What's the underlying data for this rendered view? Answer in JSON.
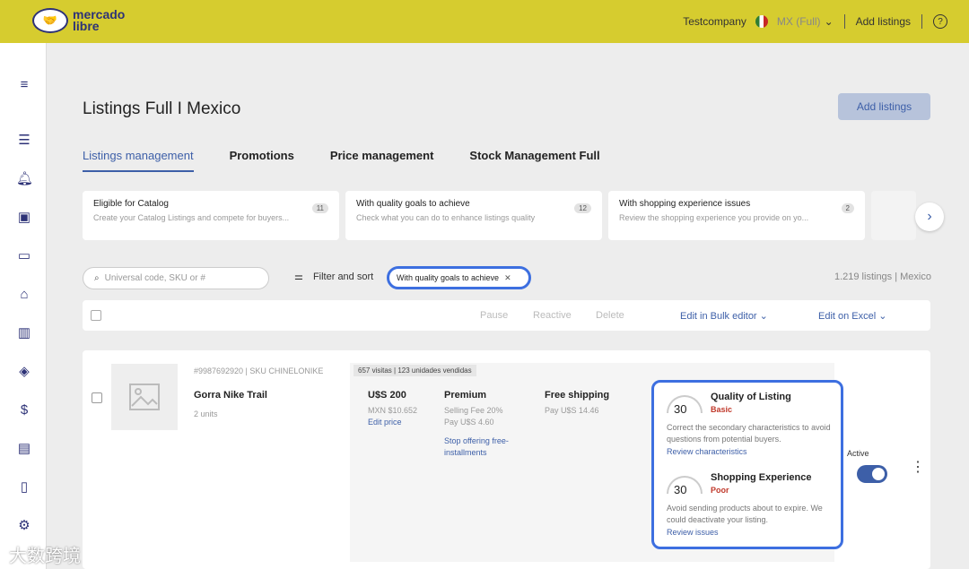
{
  "brand": {
    "logo_text": "mercado\nlibre",
    "accent": "#3d5fa8",
    "topbar_color": "#d6cc2f"
  },
  "topbar": {
    "company": "Testcompany",
    "country": "MX (Full)",
    "add_listings": "Add listings",
    "help": "?"
  },
  "page": {
    "title": "Listings Full I Mexico",
    "add_button": "Add listings"
  },
  "tabs": [
    {
      "label": "Listings management",
      "active": true
    },
    {
      "label": "Promotions"
    },
    {
      "label": "Price management"
    },
    {
      "label": "Stock Management Full"
    }
  ],
  "cards": [
    {
      "title": "Eligible for Catalog",
      "sub": "Create your Catalog Listings and compete for buyers...",
      "badge": "11"
    },
    {
      "title": "With quality goals to achieve",
      "sub": "Check what you can do to enhance listings quality",
      "badge": "12"
    },
    {
      "title": "With shopping experience issues",
      "sub": "Review the shopping experience you provide on yo...",
      "badge": "2"
    }
  ],
  "search": {
    "placeholder": "Universal code, SKU or #"
  },
  "filter": {
    "label": "Filter and sort",
    "chip": "With quality goals to achieve",
    "count": "1.219 listings | Mexico"
  },
  "bulk": {
    "pause": "Pause",
    "reactive": "Reactive",
    "delete": "Delete",
    "bulk_editor": "Edit in Bulk editor",
    "excel": "Edit on Excel"
  },
  "listing": {
    "meta": "#9987692920 | SKU CHINELONIKE",
    "name": "Gorra Nike Trail",
    "units": "2 units",
    "visits": "657 visitas | 123 unidades vendidas",
    "price": "U$S 200",
    "price_sub": "MXN $10.652",
    "edit_price": "Edit price",
    "plan": "Premium",
    "fee": "Selling Fee 20%",
    "pay": "Pay U$S 4.60",
    "stop": "Stop offering free-\ninstallments",
    "shipping": "Free shipping",
    "ship_pay": "Pay U$S 14.46",
    "status": "Active"
  },
  "quality": {
    "score": "30",
    "title": "Quality of Listing",
    "level": "Basic",
    "desc": "Correct the secondary characteristics to avoid questions from potential buyers.",
    "link": "Review characteristics"
  },
  "experience": {
    "score": "30",
    "title": "Shopping Experience",
    "level": "Poor",
    "desc": "Avoid sending products about to expire. We could deactivate your listing.",
    "link": "Review issues"
  },
  "watermark": "大数跨境"
}
